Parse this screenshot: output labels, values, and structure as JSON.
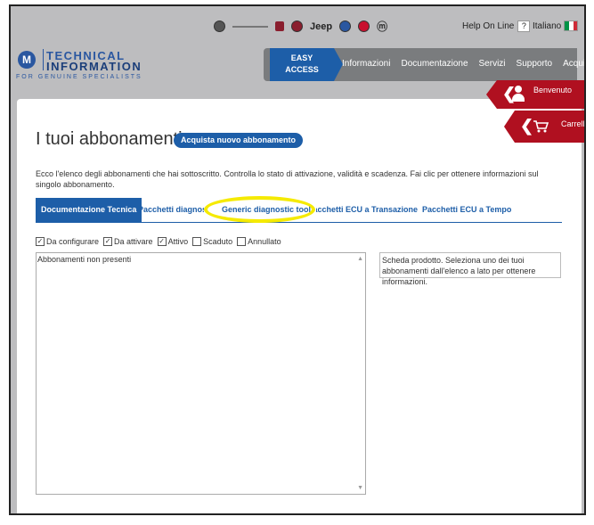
{
  "header": {
    "brand_icons": [
      "alfa-romeo-icon",
      "chrysler-wings-icon",
      "fiat-icon",
      "dodge-icon",
      "jeep-icon",
      "lancia-icon",
      "abarth-icon",
      "mopar-icon"
    ],
    "jeep_label": "Jeep",
    "help_label": "Help On Line",
    "help_icon_label": "?",
    "language_label": "Italiano",
    "flag_colors": [
      "#009246",
      "#ffffff",
      "#ce2b37"
    ]
  },
  "logo": {
    "line1": "TECHNICAL",
    "line2": "INFORMATION",
    "tagline": "FOR GENUINE SPECIALISTS",
    "mark": "M"
  },
  "nav": {
    "easy_access": "EASY ACCESS",
    "items": [
      "Informazioni",
      "Documentazione",
      "Servizi",
      "Supporto",
      "Acquista"
    ]
  },
  "account": {
    "welcome_label": "Benvenuto",
    "cart_label": "Carrello"
  },
  "page": {
    "title": "I tuoi abbonamenti",
    "buy_button": "Acquista nuovo abbonamento",
    "intro": "Ecco l'elenco degli abbonamenti che hai sottoscritto. Controlla lo stato di attivazione, validità e scadenza. Fai clic per ottenere informazioni sul singolo abbonamento."
  },
  "tabs": [
    "Documentazione Tecnica",
    "Pacchetti diagnostici",
    "Generic diagnostic tool",
    "Pacchetti ECU a Transazione",
    "Pacchetti ECU a Tempo"
  ],
  "filters": [
    {
      "label": "Da configurare",
      "checked": true
    },
    {
      "label": "Da attivare",
      "checked": true
    },
    {
      "label": "Attivo",
      "checked": true
    },
    {
      "label": "Scaduto",
      "checked": false
    },
    {
      "label": "Annullato",
      "checked": false
    }
  ],
  "list": {
    "empty_text": "Abbonamenti non presenti"
  },
  "info_panel": {
    "text": "Scheda prodotto. Seleziona uno dei tuoi abbonamenti dall'elenco a lato per ottenere informazioni."
  },
  "colors": {
    "accent": "#1d5ea8",
    "red": "#b01020",
    "highlight": "#f5ea00",
    "header_bg": "#bdbdbf"
  }
}
